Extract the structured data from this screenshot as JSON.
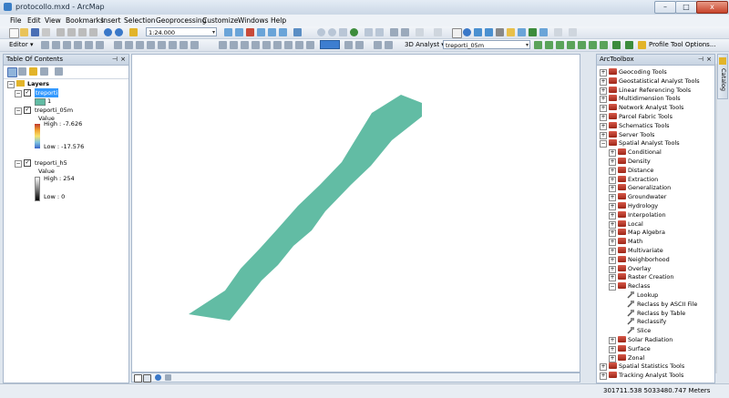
{
  "window": {
    "title": "protocollo.mxd - ArcMap",
    "minimize": "–",
    "maximize": "□",
    "close": "x"
  },
  "menu": [
    "File",
    "Edit",
    "View",
    "Bookmarks",
    "Insert",
    "Selection",
    "Geoprocessing",
    "Customize",
    "Windows",
    "Help"
  ],
  "toolbar1": {
    "scale_value": "1:24.000"
  },
  "toolbar2": {
    "editor_label": "Editor ▾",
    "analyst_label": "3D Analyst ▾",
    "layer_value": "treporti_05m",
    "profile_label": "Profile Tool Options..."
  },
  "toc": {
    "title": "Table Of Contents",
    "layers_label": "Layers",
    "layer1": {
      "name": "treporti",
      "value": "1",
      "color": "#62bca4"
    },
    "layer2": {
      "name": "treporti_05m",
      "value_label": "Value",
      "high": "High : -7.626",
      "low": "Low : -17.576"
    },
    "layer3": {
      "name": "treporti_h5",
      "value_label": "Value",
      "high": "High : 254",
      "low": "Low : 0"
    }
  },
  "map": {
    "polygon_color": "#62bca4"
  },
  "toolbox": {
    "title": "ArcToolbox",
    "toolsets": [
      "Geocoding Tools",
      "Geostatistical Analyst Tools",
      "Linear Referencing Tools",
      "Multidimension Tools",
      "Network Analyst Tools",
      "Parcel Fabric Tools",
      "Schematics Tools",
      "Server Tools",
      "Spatial Analyst Tools"
    ],
    "spatial_children": [
      "Conditional",
      "Density",
      "Distance",
      "Extraction",
      "Generalization",
      "Groundwater",
      "Hydrology",
      "Interpolation",
      "Local",
      "Map Algebra",
      "Math",
      "Multivariate",
      "Neighborhood",
      "Overlay",
      "Raster Creation",
      "Reclass"
    ],
    "reclass_tools": [
      "Lookup",
      "Reclass by ASCII File",
      "Reclass by Table",
      "Reclassify",
      "Slice"
    ],
    "after_reclass": [
      "Solar Radiation",
      "Surface",
      "Zonal"
    ],
    "trailing": [
      "Spatial Statistics Tools",
      "Tracking Analyst Tools"
    ]
  },
  "catalog_tab": "Catalog",
  "status": {
    "coords": "301711.538  5033480.747 Meters"
  }
}
